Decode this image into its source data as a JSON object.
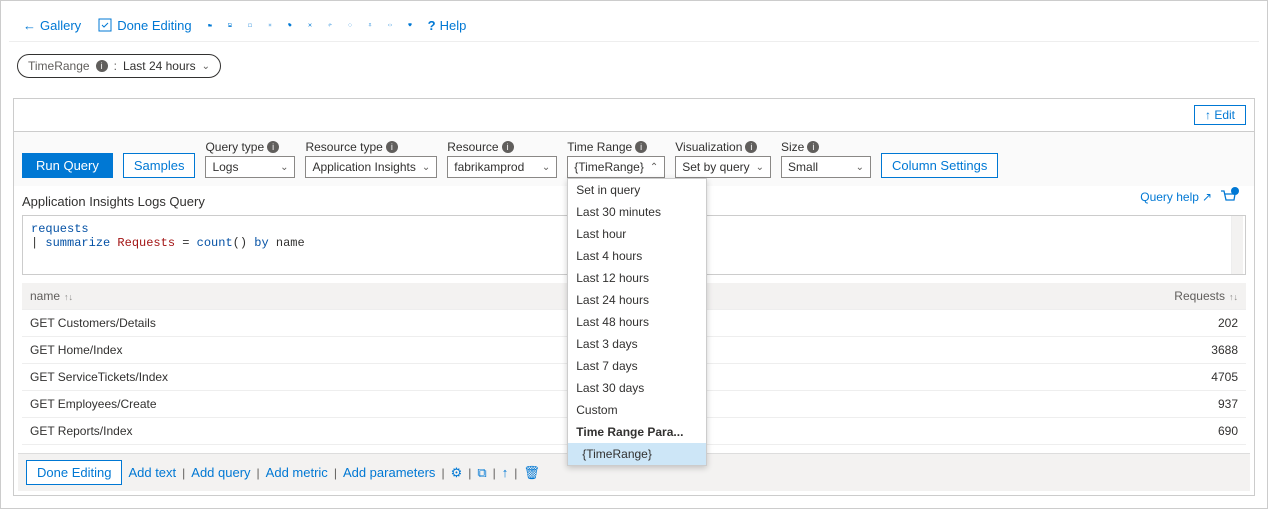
{
  "toolbar": {
    "gallery": "Gallery",
    "done_editing": "Done Editing",
    "help": "Help"
  },
  "param": {
    "name": "TimeRange",
    "sep": ":",
    "value": "Last 24 hours"
  },
  "edit_button": "↑ Edit",
  "query": {
    "run": "Run Query",
    "samples": "Samples",
    "query_type_label": "Query type",
    "query_type_value": "Logs",
    "resource_type_label": "Resource type",
    "resource_type_value": "Application Insights",
    "resource_label": "Resource",
    "resource_value": "fabrikamprod",
    "time_range_label": "Time Range",
    "time_range_value": "{TimeRange}",
    "visualization_label": "Visualization",
    "visualization_value": "Set by query",
    "size_label": "Size",
    "size_value": "Small",
    "column_settings": "Column Settings"
  },
  "time_range_options": [
    "Set in query",
    "Last 30 minutes",
    "Last hour",
    "Last 4 hours",
    "Last 12 hours",
    "Last 24 hours",
    "Last 48 hours",
    "Last 3 days",
    "Last 7 days",
    "Last 30 days",
    "Custom"
  ],
  "time_range_header": "Time Range Para...",
  "time_range_selected": "{TimeRange}",
  "body": {
    "title": "Application Insights Logs Query",
    "code_line1": "requests",
    "code_line2_pipe": "| ",
    "code_line2_kw1": "summarize",
    "code_line2_var": " Requests ",
    "code_line2_eq": "= ",
    "code_line2_fn": "count",
    "code_line2_paren": "() ",
    "code_line2_kw2": "by",
    "code_line2_col": " name",
    "query_help": "Query help"
  },
  "table": {
    "col_name": "name",
    "col_requests": "Requests",
    "rows": [
      {
        "name": "GET Customers/Details",
        "requests": "202"
      },
      {
        "name": "GET Home/Index",
        "requests": "3688"
      },
      {
        "name": "GET ServiceTickets/Index",
        "requests": "4705"
      },
      {
        "name": "GET Employees/Create",
        "requests": "937"
      },
      {
        "name": "GET Reports/Index",
        "requests": "690"
      }
    ]
  },
  "footer": {
    "done_editing": "Done Editing",
    "add_text": "Add text",
    "add_query": "Add query",
    "add_metric": "Add metric",
    "add_parameters": "Add parameters"
  }
}
